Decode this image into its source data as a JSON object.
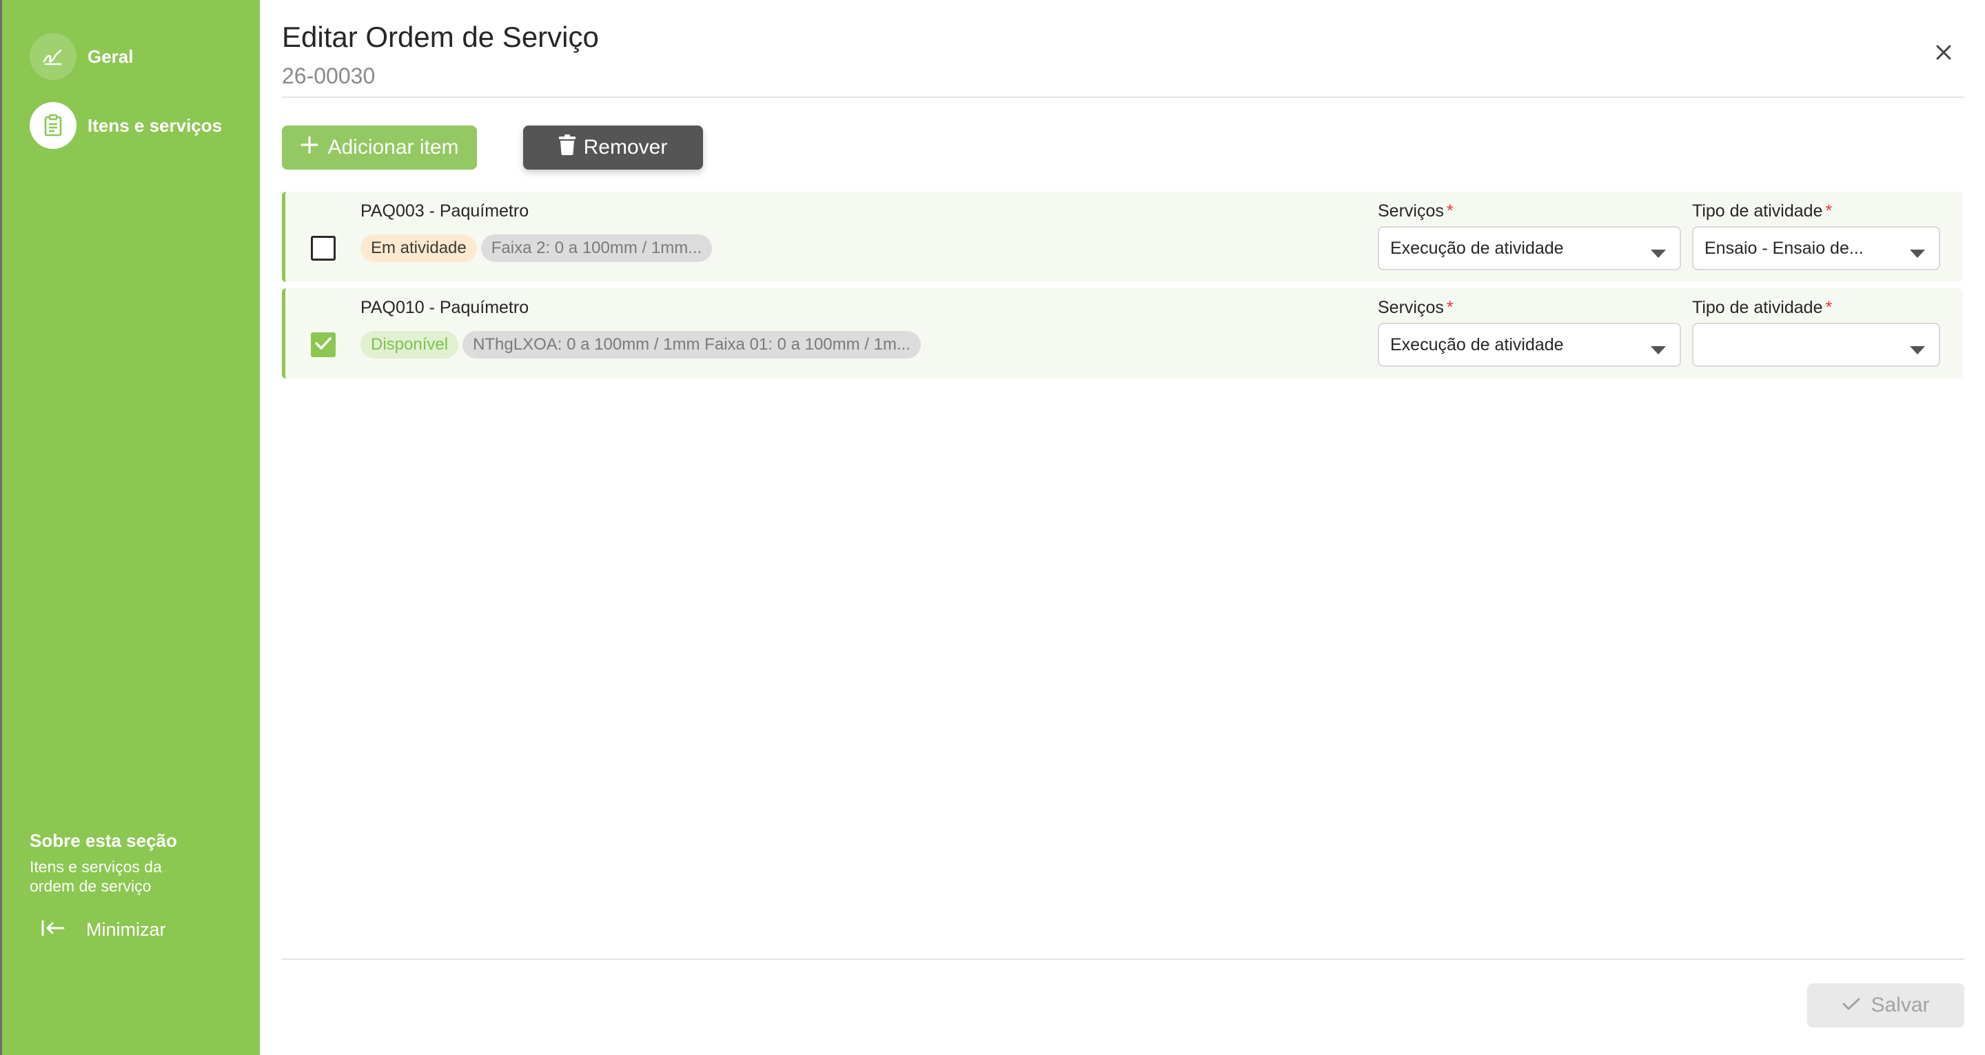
{
  "sidebar": {
    "items": [
      {
        "label": "Geral",
        "icon": "signature-icon",
        "active": false
      },
      {
        "label": "Itens e serviços",
        "icon": "clipboard-icon",
        "active": true
      }
    ],
    "about_title": "Sobre esta seção",
    "about_desc": "Itens e serviços da ordem de serviço",
    "minimize_label": "Minimizar"
  },
  "header": {
    "title": "Editar Ordem de Serviço",
    "code": "26-00030"
  },
  "toolbar": {
    "add_label": "Adicionar item",
    "remove_label": "Remover"
  },
  "items": [
    {
      "name": "PAQ003 - Paquímetro",
      "checked": false,
      "status": "Em atividade",
      "status_color": "#fce9cf",
      "range": "Faixa 2: 0 a 100mm / 1mm...",
      "services_label": "Serviços",
      "services_value": "Execução de atividade",
      "activity_label": "Tipo de atividade",
      "activity_value": "Ensaio - Ensaio de..."
    },
    {
      "name": "PAQ010 - Paquímetro",
      "checked": true,
      "status": "Disponível",
      "status_color": "#e0f0d0",
      "range": "NThgLXOA: 0 a 100mm / 1mm Faixa 01: 0 a 100mm / 1m...",
      "services_label": "Serviços",
      "services_value": "Execução de atividade",
      "activity_label": "Tipo de atividade",
      "activity_value": ""
    }
  ],
  "footer": {
    "save_label": "Salvar"
  },
  "colors": {
    "sidebar_bg": "#8bc751",
    "accent": "#8bc751",
    "remove_bg": "#555555",
    "required": "#e53935"
  }
}
